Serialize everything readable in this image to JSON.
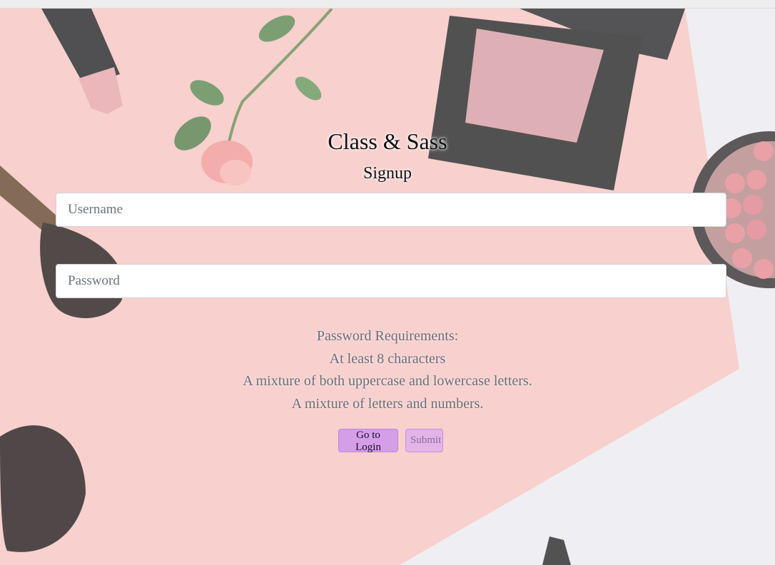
{
  "header": {
    "brand": "Class & Sass",
    "form_title": "Signup"
  },
  "form": {
    "username_placeholder": "Username",
    "username_value": "",
    "password_placeholder": "Password",
    "password_value": ""
  },
  "requirements": {
    "heading": "Password Requirements:",
    "items": [
      "At least 8 characters",
      "A mixture of both uppercase and lowercase letters.",
      "A mixture of letters and numbers."
    ]
  },
  "buttons": {
    "login_label": "Go to Login",
    "submit_label": "Submit",
    "submit_disabled": true
  },
  "colors": {
    "backdrop_pink": "#f7c6c3",
    "backdrop_white": "#ecebf0",
    "button_purple": "#d59ee8",
    "button_disabled": "#e3b4e8"
  },
  "decor": {
    "background_items": [
      "lipstick-icon",
      "rose-icon",
      "blush-compact-icon",
      "brush-icon",
      "pearl-blush-icon"
    ]
  }
}
